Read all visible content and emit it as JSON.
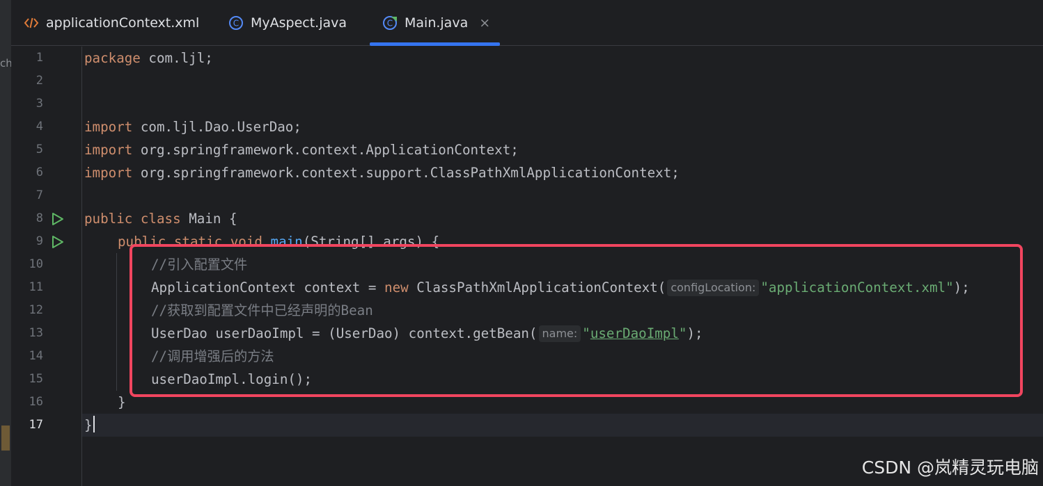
{
  "left_strip": {
    "cut_text": "ch"
  },
  "tabs": [
    {
      "label": "applicationContext.xml",
      "icon": "xml-file-icon",
      "active": false
    },
    {
      "label": "MyAspect.java",
      "icon": "java-class-icon",
      "active": false
    },
    {
      "label": "Main.java",
      "icon": "java-main-class-icon",
      "active": true
    }
  ],
  "tab_close_glyph": "×",
  "line_numbers": [
    "1",
    "2",
    "3",
    "4",
    "5",
    "6",
    "7",
    "8",
    "9",
    "10",
    "11",
    "12",
    "13",
    "14",
    "15",
    "16",
    "17"
  ],
  "current_line": "17",
  "code": {
    "l1": {
      "kw": "package",
      "rest": " com.ljl;"
    },
    "l4": {
      "kw": "import",
      "rest": " com.ljl.Dao.UserDao;"
    },
    "l5": {
      "kw": "import",
      "rest": " org.springframework.context.ApplicationContext;"
    },
    "l6": {
      "kw": "import",
      "rest": " org.springframework.context.support.ClassPathXmlApplicationContext;"
    },
    "l8": {
      "kw1": "public",
      "kw2": "class",
      "name": "Main",
      "brace": "{"
    },
    "l9": {
      "kw1": "public",
      "kw2": "static",
      "kw3": "void",
      "fn": "main",
      "rest": "(String[] args) {"
    },
    "l10": {
      "comment": "//引入配置文件"
    },
    "l11": {
      "pre": "ApplicationContext context = ",
      "kw": "new",
      "call": " ClassPathXmlApplicationContext(",
      "hint": "configLocation:",
      "str": "\"applicationContext.xml\"",
      "post": ");"
    },
    "l12": {
      "comment": "//获取到配置文件中已经声明的Bean"
    },
    "l13": {
      "pre": "UserDao userDaoImpl = (UserDao) context.getBean(",
      "hint": "name:",
      "q1": "\"",
      "str": "userDaoImpl",
      "q2": "\"",
      "post": ");"
    },
    "l14": {
      "comment": "//调用增强后的方法"
    },
    "l15": {
      "text": "userDaoImpl.login();"
    },
    "l16": {
      "text": "}"
    },
    "l17": {
      "text": "}"
    }
  },
  "watermark": "CSDN @岚精灵玩电脑",
  "colors": {
    "editor_bg": "#1e1f22",
    "keyword": "#cf8e6d",
    "string": "#6aab73",
    "comment": "#7a7e85",
    "function": "#56a8f5",
    "highlight_box": "#f1455f",
    "active_tab_underline": "#3574f0"
  }
}
